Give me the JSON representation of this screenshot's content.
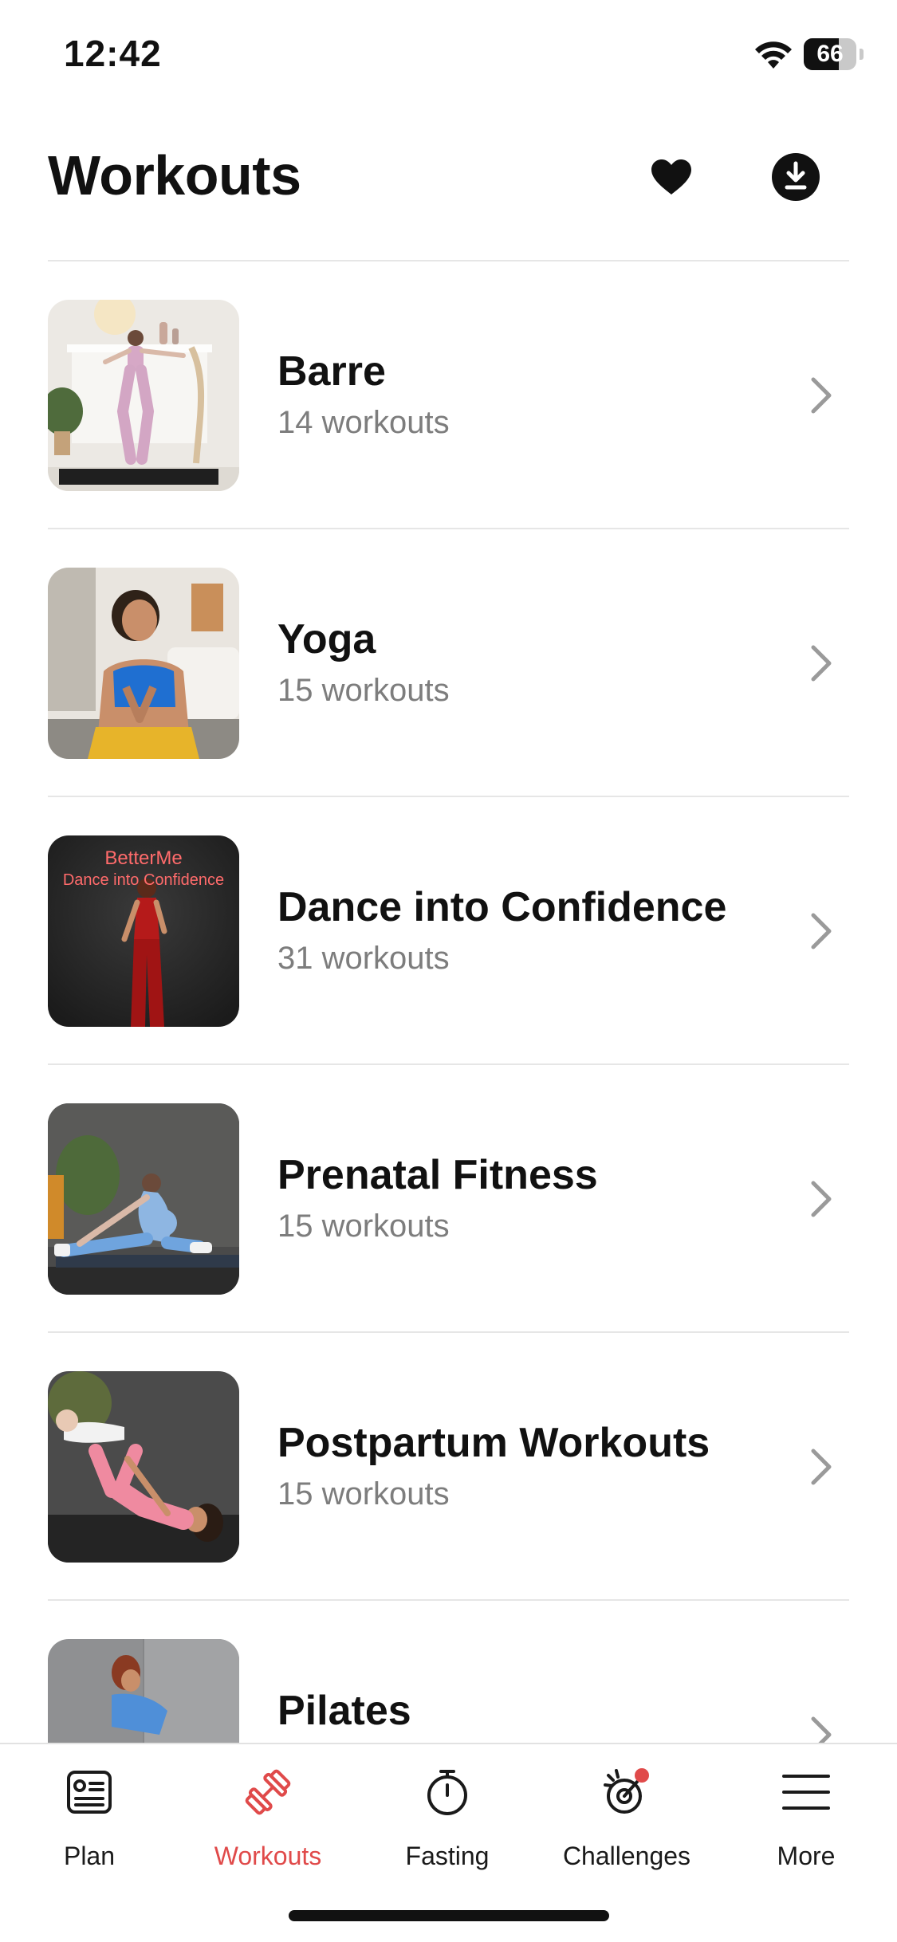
{
  "status_bar": {
    "time": "12:42",
    "battery_level": "66",
    "battery_fraction": 0.66,
    "wifi_icon": "wifi-icon"
  },
  "header": {
    "title": "Workouts",
    "favorites_icon": "heart-icon",
    "downloads_icon": "download-icon"
  },
  "categories": [
    {
      "title": "Barre",
      "subtitle": "14 workouts",
      "image": "barre-photo"
    },
    {
      "title": "Yoga",
      "subtitle": "15 workouts",
      "image": "yoga-photo"
    },
    {
      "title": "Dance into Confidence",
      "subtitle": "31 workouts",
      "image": "dance-photo",
      "image_text_1": "BetterMe",
      "image_text_2": "Dance into Confidence"
    },
    {
      "title": "Prenatal Fitness",
      "subtitle": "15 workouts",
      "image": "prenatal-photo"
    },
    {
      "title": "Postpartum Workouts",
      "subtitle": "15 workouts",
      "image": "postpartum-photo"
    },
    {
      "title": "Pilates",
      "subtitle": "",
      "image": "pilates-photo"
    }
  ],
  "tab_bar": {
    "active": "Workouts",
    "tabs": [
      {
        "label": "Plan",
        "icon": "plan-icon"
      },
      {
        "label": "Workouts",
        "icon": "dumbbell-icon"
      },
      {
        "label": "Fasting",
        "icon": "stopwatch-icon"
      },
      {
        "label": "Challenges",
        "icon": "target-icon",
        "has_notification_dot": true
      },
      {
        "label": "More",
        "icon": "menu-icon"
      }
    ]
  },
  "colors": {
    "accent": "#e04a4a",
    "text_primary": "#111111",
    "text_secondary": "#7d7d7d",
    "divider": "#e6e6e6"
  }
}
